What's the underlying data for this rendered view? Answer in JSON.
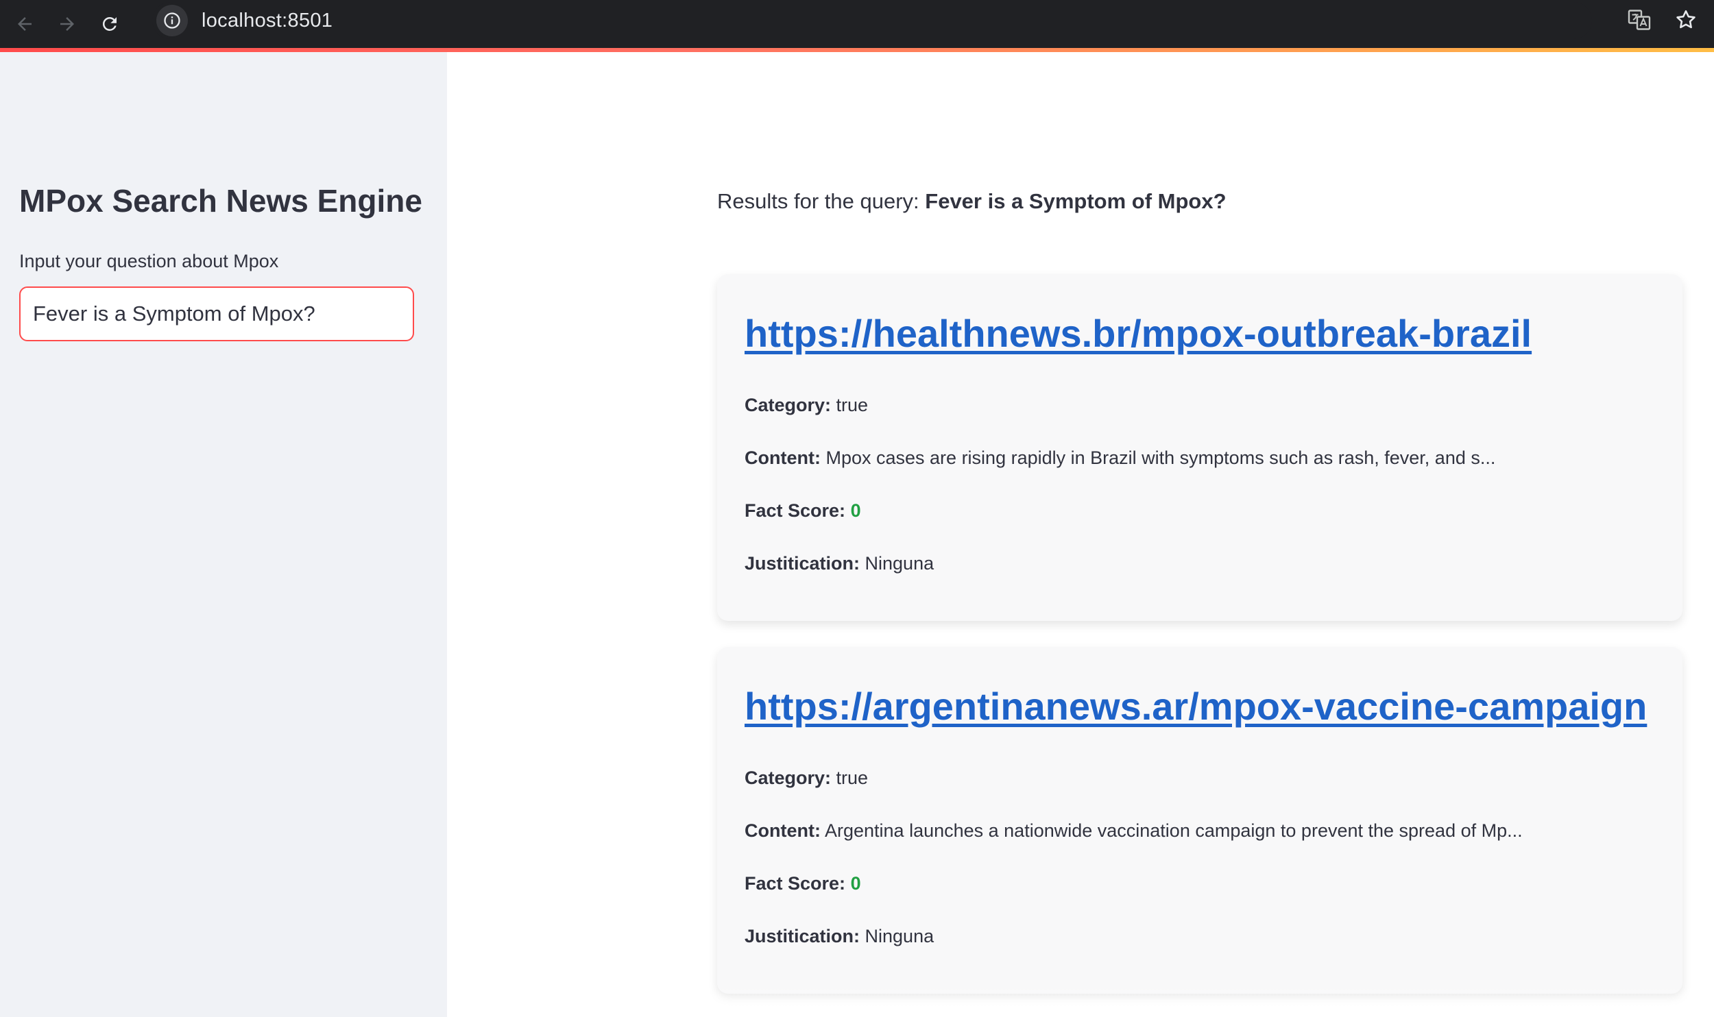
{
  "browser": {
    "url": "localhost:8501"
  },
  "sidebar": {
    "title": "MPox Search News Engine",
    "input_label": "Input your question about Mpox",
    "input_value": "Fever is a Symptom of Mpox?"
  },
  "main": {
    "results_prefix": "Results for the query:",
    "query": "Fever is a Symptom of Mpox?",
    "labels": {
      "category": "Category:",
      "content": "Content:",
      "fact_score": "Fact Score:",
      "justification": "Justitication:"
    },
    "results": [
      {
        "url": "https://healthnews.br/mpox-outbreak-brazil",
        "category": "true",
        "content": "Mpox cases are rising rapidly in Brazil with symptoms such as rash, fever, and s...",
        "fact_score": "0",
        "justification": "Ninguna"
      },
      {
        "url": "https://argentinanews.ar/mpox-vaccine-campaign",
        "category": "true",
        "content": "Argentina launches a nationwide vaccination campaign to prevent the spread of Mp...",
        "fact_score": "0",
        "justification": "Ninguna"
      }
    ]
  },
  "colors": {
    "accent": "#ff4b4b",
    "link": "#1f63c8",
    "score": "#21a043",
    "sidebar_bg": "#f0f2f6"
  }
}
